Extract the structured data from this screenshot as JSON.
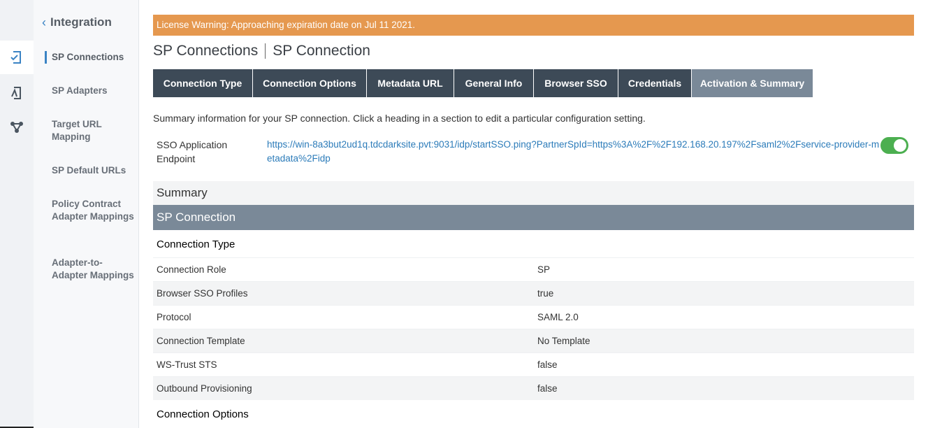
{
  "sidebar": {
    "back_label": "Integration",
    "items": [
      {
        "label": "SP Connections",
        "active": true
      },
      {
        "label": "SP Adapters"
      },
      {
        "label": "Target URL Mapping"
      },
      {
        "label": "SP Default URLs"
      },
      {
        "label": "Policy Contract Adapter Mappings"
      },
      {
        "label": "Adapter-to-Adapter Mappings"
      }
    ]
  },
  "rail": {
    "icons": [
      "connection-icon",
      "adapter-icon",
      "network-icon"
    ],
    "accent": "#3a83c4"
  },
  "warning": {
    "text": "License Warning: Approaching expiration date on Jul 11 2021.",
    "color": "#e5984f"
  },
  "header": {
    "title_part1": "SP Connections",
    "title_part2": "SP Connection"
  },
  "tabs": [
    {
      "label": "Connection Type"
    },
    {
      "label": "Connection Options"
    },
    {
      "label": "Metadata URL"
    },
    {
      "label": "General Info"
    },
    {
      "label": "Browser SSO"
    },
    {
      "label": "Credentials"
    },
    {
      "label": "Activation & Summary",
      "active": true
    }
  ],
  "description": "Summary information for your SP connection. Click a heading in a section to edit a particular configuration setting.",
  "sso": {
    "label": "SSO Application Endpoint",
    "url": "https://win-8a3but2ud1q.tdcdarksite.pvt:9031/idp/startSSO.ping?PartnerSpId=https%3A%2F%2F192.168.20.197%2Fsaml2%2Fservice-provider-metadata%2Fidp",
    "enabled": true,
    "toggle_color": "#4caf50"
  },
  "summary": {
    "title": "Summary",
    "sp_connection_header": "SP Connection",
    "sections": [
      {
        "title": "Connection Type",
        "rows": [
          {
            "key": "Connection Role",
            "value": "SP"
          },
          {
            "key": "Browser SSO Profiles",
            "value": "true"
          },
          {
            "key": "Protocol",
            "value": "SAML 2.0"
          },
          {
            "key": "Connection Template",
            "value": "No Template"
          },
          {
            "key": "WS-Trust STS",
            "value": "false"
          },
          {
            "key": "Outbound Provisioning",
            "value": "false"
          }
        ]
      },
      {
        "title": "Connection Options"
      }
    ]
  }
}
